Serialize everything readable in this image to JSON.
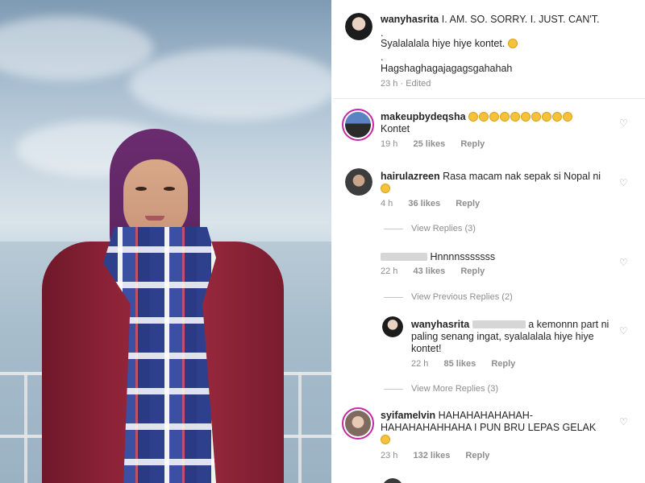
{
  "caption": {
    "username": "wanyhasrita",
    "line1": "I. AM. SO. SORRY. I. JUST. CAN'T.",
    "dot1": ".",
    "line2": "Syalalalala hiye hiye kontet.",
    "dot2": ".",
    "line3": "Hagshaghagajagagsgahahah",
    "time": "23 h",
    "edited": "Edited"
  },
  "comments": [
    {
      "username": "makeupbydeqsha",
      "emoji_count": 10,
      "text": "Kontet",
      "time": "19 h",
      "likes": "25 likes",
      "reply": "Reply"
    },
    {
      "username": "hairulazreen",
      "text": "Rasa macam nak sepak si Nopal ni",
      "time": "4 h",
      "likes": "36 likes",
      "reply": "Reply",
      "view_replies": "View Replies (3)"
    },
    {
      "username": "",
      "text": "Hnnnnsssssss",
      "time": "22 h",
      "likes": "43 likes",
      "reply": "Reply",
      "view_previous": "View Previous Replies (2)"
    },
    {
      "username": "wanyhasrita",
      "text_a": "a kemonnn part ni",
      "text_b": "paling senang ingat, syalalalala hiye hiye",
      "text_c": "kontet!",
      "time": "22 h",
      "likes": "85 likes",
      "reply": "Reply",
      "view_more": "View More Replies (3)"
    },
    {
      "username": "syifamelvin",
      "text_a": "HAHAHAHAHAHAH-",
      "text_b": "HAHAHAHAHHAHA I PUN BRU LEPAS GELAK",
      "time": "23 h",
      "likes": "132 likes",
      "reply": "Reply"
    }
  ],
  "icons": {
    "heart": "heart-outline-icon",
    "emoji": "laughing-emoji-icon"
  },
  "colors": {
    "text": "#262626",
    "muted": "#8e8e8e",
    "story_ring": "#c32aa3"
  }
}
